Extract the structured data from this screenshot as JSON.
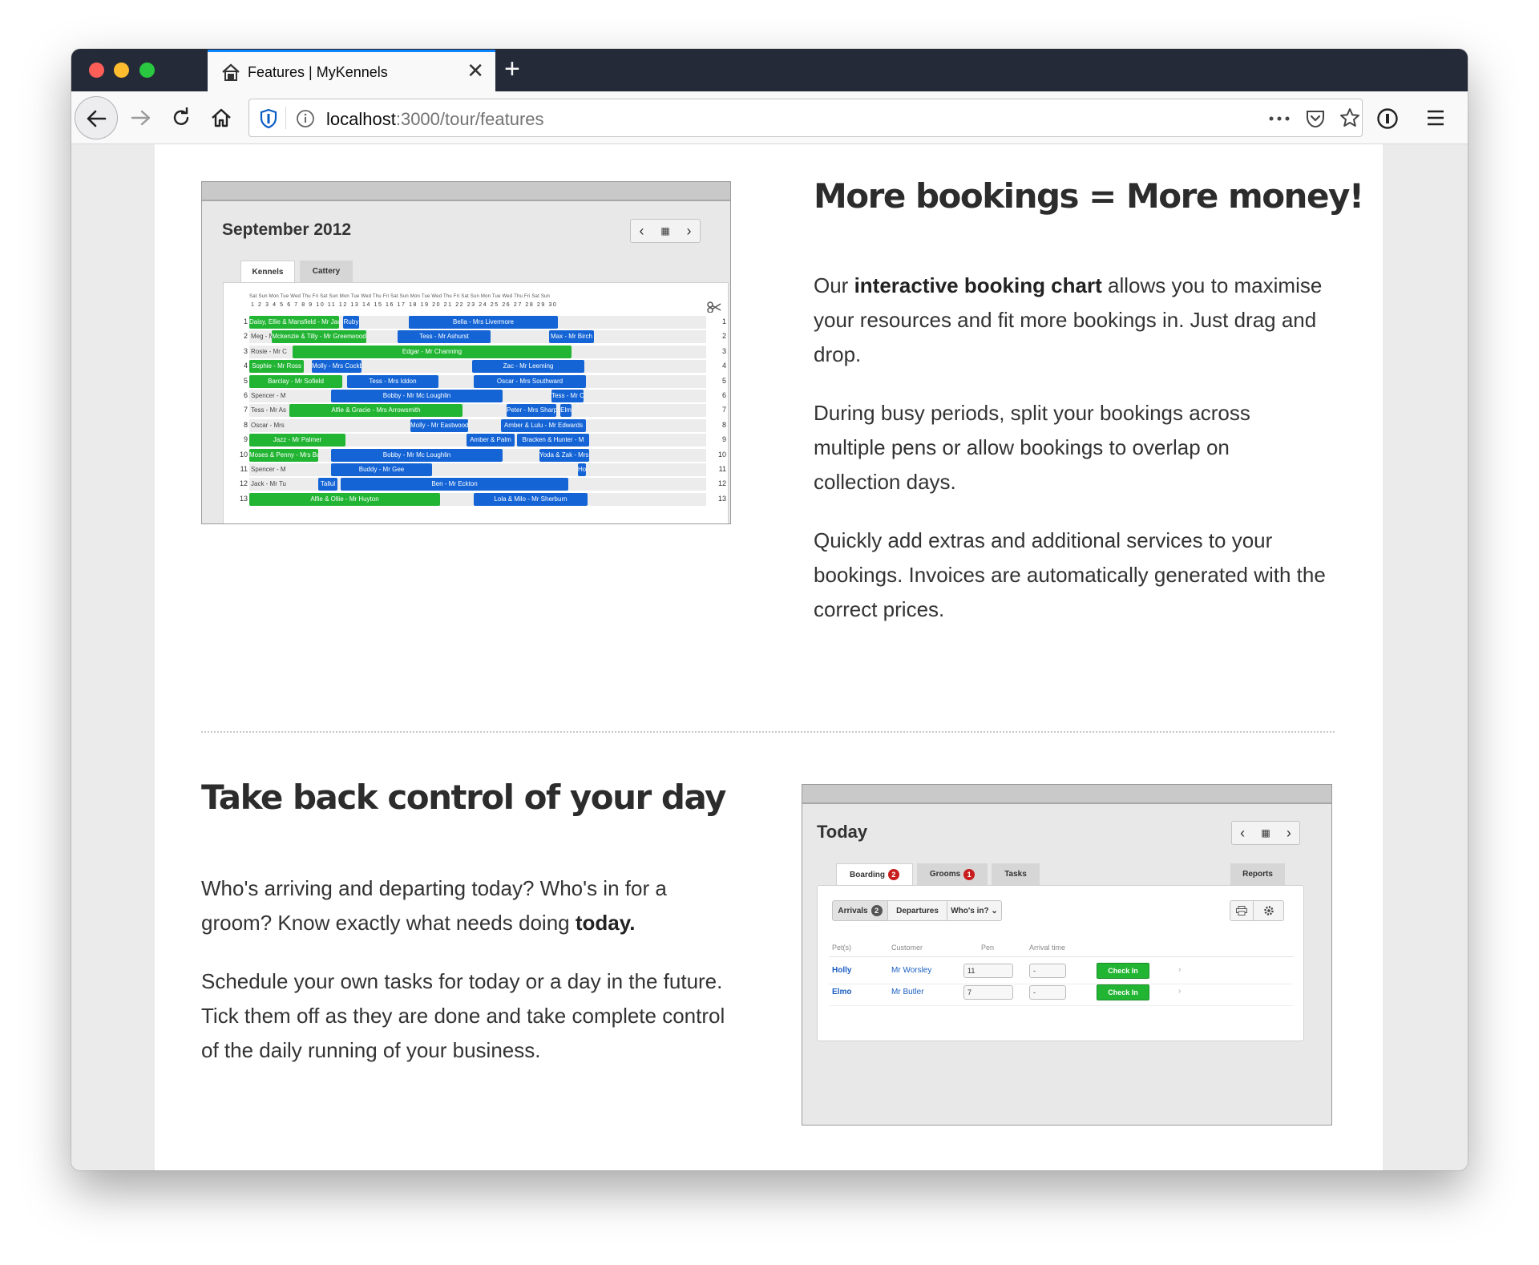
{
  "browser": {
    "tab_title": "Features | MyKennels",
    "tab_icon": "house-icon",
    "url_host": "localhost",
    "url_path": ":3000/tour/features",
    "new_tab_label": "+",
    "close_tab_label": "✕",
    "accent_color": "#0a84ff",
    "titlebar_color": "#252a39"
  },
  "section1": {
    "heading": "More bookings = More money!",
    "p1_a": "Our ",
    "p1_b": "interactive booking chart",
    "p1_c": " allows you to maximise your resources and fit more bookings in. Just drag and drop.",
    "p2": "During busy periods, split your bookings across multiple pens or allow bookings to overlap on collection days.",
    "p3": "Quickly add extras and additional services to your bookings. Invoices are automatically generated with the correct prices."
  },
  "booking_chart": {
    "title": "September 2012",
    "tabs": [
      "Kennels",
      "Cattery"
    ],
    "day_header": "Sat Sun Mon Tue Wed Thu Fri Sat Sun Mon Tue Wed Thu Fri Sat Sun Mon Tue Wed Thu Fri Sat Sun Mon Tue Wed Thu Fri Sat Sun",
    "date_header": "1 2 3 4 5 6 7 8 9 10 11 12 13 14 15 16 17 18 19 20 21 22 23 24 25 26 27 28 29 30",
    "rows": [
      {
        "n": "1",
        "label": "",
        "bars": [
          {
            "c": "g",
            "t": "Daisy, Ellie & Mansfield - Mr Jack"
          },
          {
            "c": "b",
            "t": "Ruby"
          },
          {
            "c": "b",
            "t": "Bella - Mrs Livermore"
          }
        ]
      },
      {
        "n": "2",
        "label": "Meg - Mr Ro",
        "bars": [
          {
            "c": "g",
            "t": "Mckenzie & Tilly - Mr Greenwood"
          },
          {
            "c": "b",
            "t": "Tess - Mr Ashurst"
          },
          {
            "c": "b",
            "t": "Max - Mr Birch"
          }
        ]
      },
      {
        "n": "3",
        "label": "Rosie - Mr C",
        "bars": [
          {
            "c": "g",
            "t": "Edgar - Mr Channing"
          }
        ]
      },
      {
        "n": "4",
        "label": "",
        "bars": [
          {
            "c": "g",
            "t": "Sophie - Mr Ross"
          },
          {
            "c": "b",
            "t": "Molly - Mrs Cockbu"
          },
          {
            "c": "b",
            "t": "Zac - Mr Leeming"
          }
        ]
      },
      {
        "n": "5",
        "label": "",
        "bars": [
          {
            "c": "g",
            "t": "Barclay - Mr Sofield"
          },
          {
            "c": "b",
            "t": "Tess - Mrs Iddon"
          },
          {
            "c": "b",
            "t": "Oscar - Mrs Southward"
          }
        ]
      },
      {
        "n": "6",
        "label": "Spencer - M",
        "bars": [
          {
            "c": "b",
            "t": "Bobby - Mr Mc Loughlin"
          },
          {
            "c": "b",
            "t": "Tess - Mr C"
          }
        ]
      },
      {
        "n": "7",
        "label": "Tess - Mr As",
        "bars": [
          {
            "c": "g",
            "t": "Alfie & Gracie - Mrs Arrowsmith"
          },
          {
            "c": "b",
            "t": "Peter - Mrs Sharples"
          },
          {
            "c": "b",
            "t": "Elm"
          }
        ]
      },
      {
        "n": "8",
        "label": "Oscar - Mrs",
        "bars": [
          {
            "c": "b",
            "t": "Molly - Mr Eastwood"
          },
          {
            "c": "b",
            "t": "Amber & Lulu - Mr Edwards"
          }
        ]
      },
      {
        "n": "9",
        "label": "",
        "bars": [
          {
            "c": "g",
            "t": "Jazz - Mr Palmer"
          },
          {
            "c": "b",
            "t": "Amber & Palm"
          },
          {
            "c": "b",
            "t": "Bracken & Hunter - M"
          }
        ]
      },
      {
        "n": "10",
        "label": "",
        "bars": [
          {
            "c": "g",
            "t": "Moses & Penny - Mrs Bal"
          },
          {
            "c": "b",
            "t": "Bobby - Mr Mc Loughlin"
          },
          {
            "c": "b",
            "t": "Yoda & Zak - Mrs Jackson"
          }
        ]
      },
      {
        "n": "11",
        "label": "Spencer - M",
        "bars": [
          {
            "c": "b",
            "t": "Buddy - Mr Gee"
          },
          {
            "c": "b",
            "t": "Ho"
          }
        ]
      },
      {
        "n": "12",
        "label": "Jack - Mr Tu",
        "bars": [
          {
            "c": "b",
            "t": "Tallul"
          },
          {
            "c": "b",
            "t": "Ben - Mr Eckton"
          }
        ]
      },
      {
        "n": "13",
        "label": "",
        "bars": [
          {
            "c": "g",
            "t": "Alfie & Ollie - Mr Huyton"
          },
          {
            "c": "b",
            "t": "Lola & Milo - Mr Sherburn"
          }
        ]
      }
    ]
  },
  "section2": {
    "heading": "Take back control of your day",
    "p1_a": "Who's arriving and departing today? Who's in for a groom? Know exactly what needs doing ",
    "p1_b": "today.",
    "p2": "Schedule your own tasks for today or a day in the future. Tick them off as they are done and take complete control of the daily running of your business."
  },
  "today": {
    "title": "Today",
    "tabs": [
      {
        "label": "Boarding",
        "badge": "2"
      },
      {
        "label": "Grooms",
        "badge": "1"
      },
      {
        "label": "Tasks",
        "badge": ""
      }
    ],
    "reports_label": "Reports",
    "subtabs": [
      {
        "label": "Arrivals",
        "badge": "2"
      },
      {
        "label": "Departures",
        "badge": ""
      },
      {
        "label": "Who's in? ⌄",
        "badge": ""
      }
    ],
    "columns": [
      "Pet(s)",
      "Customer",
      "Pen",
      "Arrival time"
    ],
    "rows": [
      {
        "pet": "Holly",
        "customer": "Mr Worsley",
        "pen": "11",
        "time": "-",
        "action": "Check In"
      },
      {
        "pet": "Elmo",
        "customer": "Mr Butler",
        "pen": "7",
        "time": "-",
        "action": "Check In"
      }
    ]
  }
}
